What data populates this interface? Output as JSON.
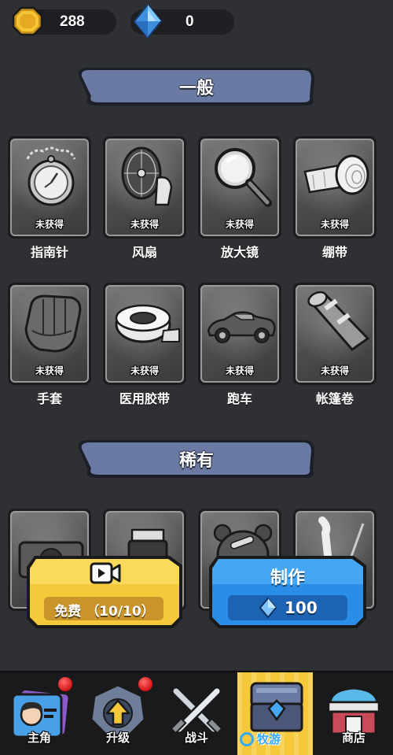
{
  "currency": {
    "coins": "288",
    "gems": "0"
  },
  "sections": {
    "common_title": "一般",
    "rare_title": "稀有"
  },
  "status_locked": "未获得",
  "common_items": [
    {
      "name": "指南针",
      "icon": "pocket-watch-compass-icon"
    },
    {
      "name": "风扇",
      "icon": "fan-icon"
    },
    {
      "name": "放大镜",
      "icon": "magnifying-glass-icon"
    },
    {
      "name": "绷带",
      "icon": "bandage-icon"
    },
    {
      "name": "手套",
      "icon": "baseball-glove-icon"
    },
    {
      "name": "医用胶带",
      "icon": "medical-tape-icon"
    },
    {
      "name": "跑车",
      "icon": "sports-car-icon"
    },
    {
      "name": "帐篷卷",
      "icon": "tent-roll-icon"
    }
  ],
  "rare_items": [
    {
      "icon": "camera-icon"
    },
    {
      "icon": "jar-icon"
    },
    {
      "icon": "teddy-bear-icon"
    },
    {
      "icon": "bone-icon"
    }
  ],
  "free_button": {
    "label": "免费",
    "count": "（10/10）",
    "icon": "video-camera-icon",
    "color": "#f5c93a"
  },
  "craft_button": {
    "label": "制作",
    "cost": "100",
    "icon": "gem-icon",
    "color": "#2b8ee6"
  },
  "nav": [
    {
      "label": "主角",
      "icon": "character-card-icon",
      "badge": true
    },
    {
      "label": "升级",
      "icon": "upgrade-arrow-icon",
      "badge": true
    },
    {
      "label": "战斗",
      "icon": "crossed-swords-icon",
      "badge": false
    },
    {
      "label": "",
      "icon": "treasure-chest-icon",
      "badge": false,
      "active": true
    },
    {
      "label": "商店",
      "icon": "shop-icon",
      "badge": false
    }
  ],
  "watermark": {
    "text": "牧游"
  },
  "colors": {
    "background": "#2f3034",
    "banner": "#6b7aa3",
    "active_tab": "#f5c93a"
  }
}
